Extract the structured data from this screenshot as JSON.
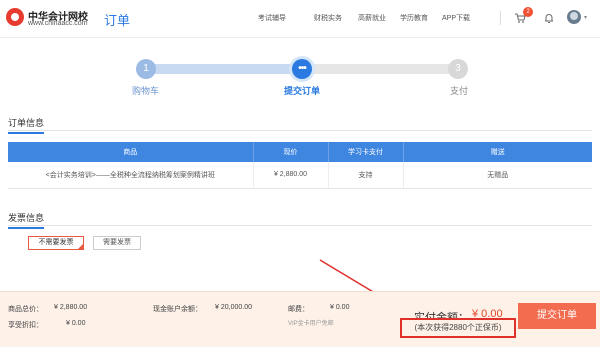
{
  "header": {
    "logo_cn": "中华会计网校",
    "logo_en": "www.chinaacc.com",
    "page_title": "订单",
    "nav": [
      {
        "label": "考试辅导",
        "has_caret": true
      },
      {
        "label": "财税实务",
        "has_caret": false
      },
      {
        "label": "高薪就业",
        "has_caret": false
      },
      {
        "label": "学历教育",
        "has_caret": false
      },
      {
        "label": "APP下载",
        "has_caret": true
      }
    ],
    "cart_badge": "2"
  },
  "stepper": {
    "steps": [
      {
        "number": "1",
        "label": "购物车",
        "state": "done"
      },
      {
        "number": "•••",
        "label": "提交订单",
        "state": "current"
      },
      {
        "number": "3",
        "label": "支付",
        "state": "todo"
      }
    ]
  },
  "order": {
    "title": "订单信息",
    "columns": [
      "商品",
      "现价",
      "学习卡支付",
      "赠送"
    ],
    "rows": [
      [
        "<会计实务培训>——全税种全流程纳税筹划案例精讲班",
        "¥ 2,880.00",
        "支持",
        "无赠品"
      ]
    ]
  },
  "invoice": {
    "title": "发票信息",
    "options": [
      "不需要发票",
      "需要发票"
    ],
    "selected": "不需要发票"
  },
  "summary": {
    "total_label": "商品总价：",
    "total_value": "¥ 2,880.00",
    "discount_label": "享受折扣：",
    "discount_value": "¥ 0.00",
    "balance_label": "现金账户余额：",
    "balance_value": "¥ 20,000.00",
    "postage_label": "邮费：",
    "postage_value": "¥ 0.00",
    "postage_note": "VIP金卡用户免邮",
    "paid_label": "实付金额：",
    "paid_value": "¥ 0.00",
    "earn_note": "(本次获得2880个正保币)",
    "submit_label": "提交订单"
  },
  "colors": {
    "brand_blue": "#2a7ae2",
    "submit_orange": "#f36c4f",
    "annotation_red": "#e0302a"
  }
}
